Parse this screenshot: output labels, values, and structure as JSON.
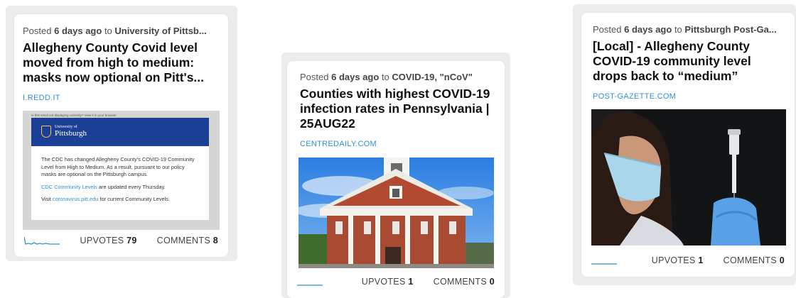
{
  "cards": [
    {
      "posted_prefix": "Posted",
      "age": "6 days ago",
      "to_word": "to",
      "community": "University of Pittsb...",
      "title": "Allegheny County Covid level moved from high to medium: masks now optional on Pitt's...",
      "domain": "I.REDD.IT",
      "upvotes_label": "UPVOTES",
      "upvotes": "79",
      "comments_label": "COMMENTS",
      "comments": "8",
      "email": {
        "preheader": "Is this email not displaying correctly? View it in your browser",
        "logo_small": "University of",
        "logo_big": "Pittsburgh",
        "body": "The CDC has changed Allegheny County's COVID-19 Community Level from High to Medium. As a result, pursuant to our policy masks are optional on the Pittsburgh campus.",
        "link1": "CDC Community Levels",
        "line2_rest": " are updated every Thursday.",
        "line3_pre": "Visit ",
        "link2": "coronavirus.pitt.edu",
        "line3_post": " for current Community Levels."
      }
    },
    {
      "posted_prefix": "Posted",
      "age": "6 days ago",
      "to_word": "to",
      "community": "COVID-19, \"nCoV\"",
      "title": "Counties with highest COVID-19 infection rates in Pennsylvania | 25AUG22",
      "domain": "CENTREDAILY.COM",
      "upvotes_label": "UPVOTES",
      "upvotes": "1",
      "comments_label": "COMMENTS",
      "comments": "0"
    },
    {
      "posted_prefix": "Posted",
      "age": "6 days ago",
      "to_word": "to",
      "community": "Pittsburgh Post-Ga...",
      "title": "[Local] - Allegheny County COVID-19 community level drops back to “medium”",
      "domain": "POST-GAZETTE.COM",
      "upvotes_label": "UPVOTES",
      "upvotes": "1",
      "comments_label": "COMMENTS",
      "comments": "0"
    }
  ],
  "colors": {
    "link": "#2f8fd6",
    "pitt_blue": "#1b3f94",
    "spark": "#2f8fd6"
  }
}
